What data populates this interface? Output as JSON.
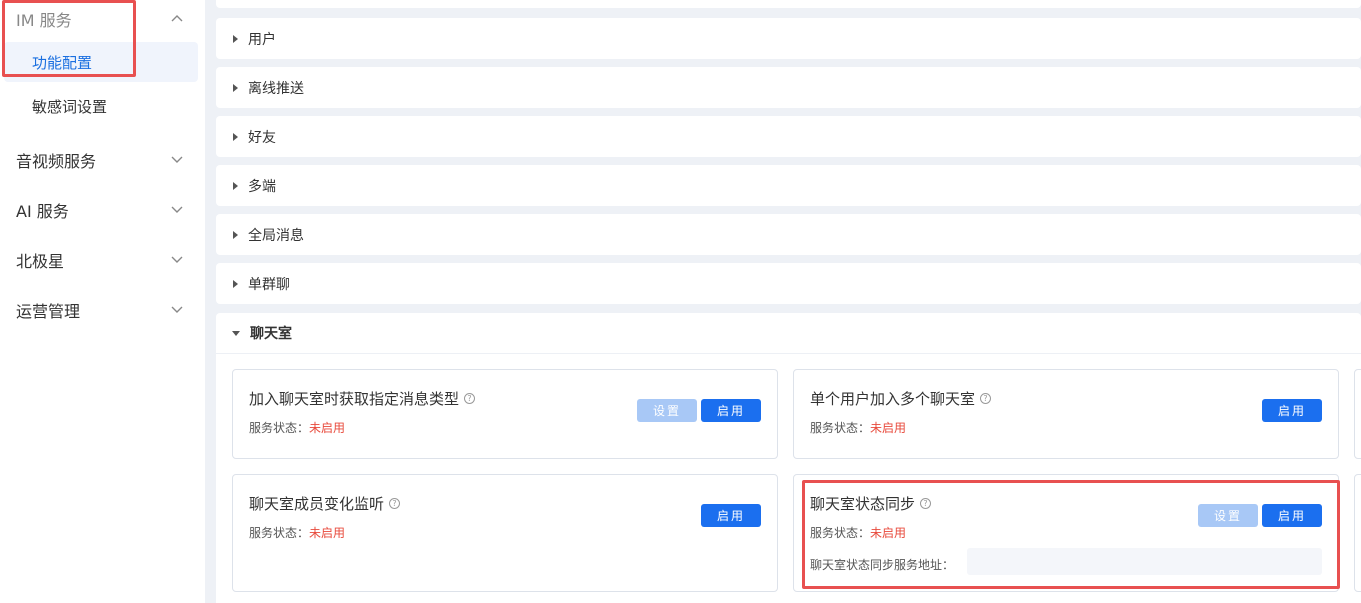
{
  "sidebar": {
    "items": [
      {
        "label": "IM 服务"
      },
      {
        "label": "功能配置"
      },
      {
        "label": "敏感词设置"
      },
      {
        "label": "音视频服务"
      },
      {
        "label": "AI 服务"
      },
      {
        "label": "北极星"
      },
      {
        "label": "运营管理"
      }
    ]
  },
  "sections": [
    {
      "label": "用户"
    },
    {
      "label": "离线推送"
    },
    {
      "label": "好友"
    },
    {
      "label": "多端"
    },
    {
      "label": "全局消息"
    },
    {
      "label": "单群聊"
    },
    {
      "label": "聊天室"
    }
  ],
  "cards": [
    {
      "title": "加入聊天室时获取指定消息类型",
      "status_label": "服务状态：",
      "status_value": "未启用",
      "settings": "设置",
      "enable": "启用"
    },
    {
      "title": "单个用户加入多个聊天室",
      "status_label": "服务状态：",
      "status_value": "未启用",
      "enable": "启用"
    },
    {
      "title": "聊天室成员变化监听",
      "status_label": "服务状态：",
      "status_value": "未启用",
      "enable": "启用"
    },
    {
      "title": "聊天室状态同步",
      "status_label": "服务状态：",
      "status_value": "未启用",
      "settings": "设置",
      "enable": "启用",
      "address_label": "聊天室状态同步服务地址：",
      "address_value": ""
    }
  ],
  "colors": {
    "primary": "#1b6fef",
    "disabled": "#a8c8f6",
    "danger": "#e84a3c",
    "highlight": "#e85050",
    "active_text": "#1a6fe0"
  }
}
